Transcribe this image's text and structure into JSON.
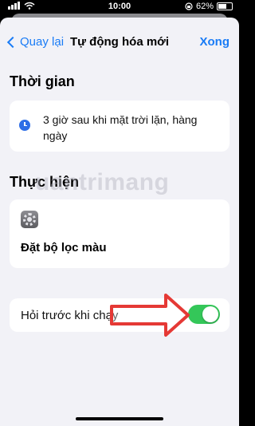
{
  "status_bar": {
    "time": "10:00",
    "battery_percent": "62%",
    "battery_level": 0.62,
    "icons": [
      "signal-bars-icon",
      "wifi-icon",
      "lock-rotation-icon",
      "battery-icon"
    ]
  },
  "nav": {
    "back_label": "Quay lại",
    "title": "Tự động hóa mới",
    "done_label": "Xong"
  },
  "time_section": {
    "header": "Thời gian",
    "icon": "clock-icon",
    "value": "3 giờ sau khi mặt trời lặn, hàng ngày"
  },
  "action_section": {
    "header": "Thực hiện",
    "icon": "settings-icon",
    "action_label": "Đặt bộ lọc màu"
  },
  "ask_row": {
    "label": "Hỏi trước khi chạy",
    "toggle_on": true
  },
  "watermark": "uantrimang",
  "colors": {
    "accent": "#1a7cf6",
    "toggle_on": "#34c759",
    "annotation_arrow": "#e53935",
    "background": "#f2f2f7"
  }
}
